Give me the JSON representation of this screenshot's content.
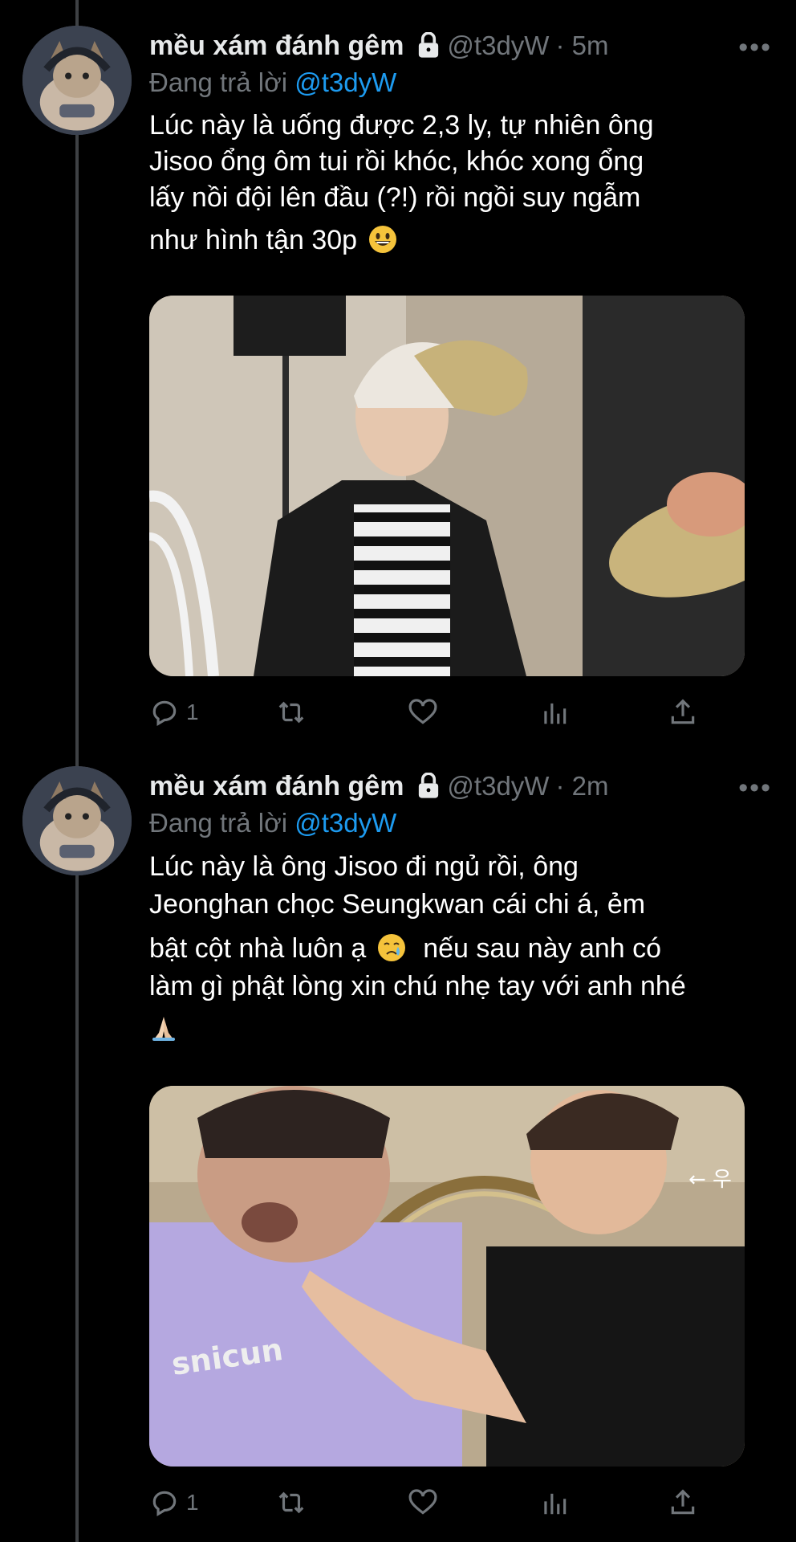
{
  "tweets": [
    {
      "name": "mều xám đánh gêm",
      "handle": "@t3dyW",
      "time": "· 5m",
      "reply_prefix": "Đang trả lời",
      "reply_to": "@t3dyW",
      "lines": [
        "Lúc này là uống được 2,3 ly, tự nhiên ông",
        "Jisoo ổng ôm tui rồi khóc, khóc xong ổng",
        "lấy nồi đội lên đầu (?!) rồi ngồi suy ngẫm",
        "như hình tận 30p"
      ],
      "emoji": "grinning-face",
      "reply_count": "1"
    },
    {
      "name": "mều xám đánh gêm",
      "handle": "@t3dyW",
      "time": "· 2m",
      "reply_prefix": "Đang trả lời",
      "reply_to": "@t3dyW",
      "lines": [
        "Lúc này là ông Jisoo đi ngủ rồi, ông",
        "Jeonghan chọc Seungkwan cái chi á, ẻm",
        "bật cột nhà luôn ạ",
        "nếu sau này anh có",
        "làm gì phật lòng xin chú nhẹ tay với anh nhé"
      ],
      "emoji": "crying-face",
      "emoji_end": "folded-hands",
      "reply_count": "1"
    }
  ],
  "more_label": "•••",
  "colors": {
    "accent": "#1d9bf0",
    "muted": "#71767b",
    "background": "#000000",
    "thread_line": "#3e4144"
  },
  "icons": [
    "lock-icon",
    "reply-icon",
    "retweet-icon",
    "like-icon",
    "analytics-icon",
    "share-icon",
    "more-icon"
  ]
}
